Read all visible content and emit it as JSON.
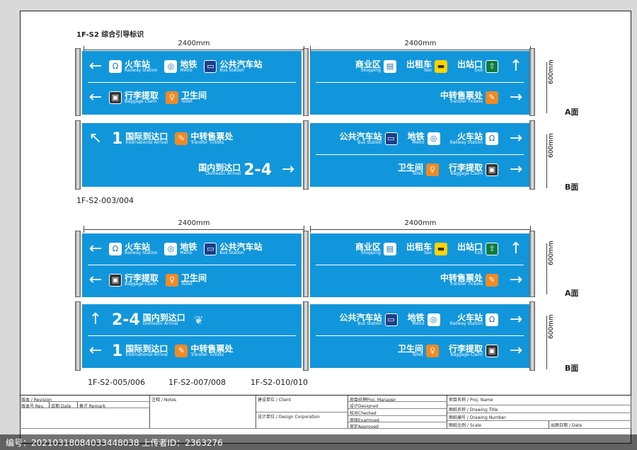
{
  "sheet_title": "1F-S2 综合引导标识",
  "dim_width": "2400mm",
  "dim_height": "600mm",
  "face_a": "A面",
  "face_b": "B面",
  "codes": [
    "1F-S2-003/004",
    "1F-S2-005/006",
    "1F-S2-007/008",
    "1F-S2-010/010"
  ],
  "dest": {
    "railway": {
      "cn": "火车站",
      "en": "Railway Station"
    },
    "metro": {
      "cn": "地铁",
      "en": "Metro"
    },
    "bus": {
      "cn": "公共汽车站",
      "en": "Bus Station"
    },
    "baggage": {
      "cn": "行李提取",
      "en": "Baggage Claim"
    },
    "toilet": {
      "cn": "卫生间",
      "en": "Toilet"
    },
    "shopping": {
      "cn": "商业区",
      "en": "Shopping"
    },
    "taxi": {
      "cn": "出租车",
      "en": "Taxi"
    },
    "exit": {
      "cn": "出站口",
      "en": "Exit"
    },
    "transfer": {
      "cn": "中转售票处",
      "en": "Transfer Tickets"
    },
    "intl": {
      "cn": "国际到达口",
      "en": "International Arrival",
      "num": "1"
    },
    "domestic": {
      "cn": "国内到达口",
      "en": "Domestic Arrival",
      "num": "2-4"
    }
  },
  "title_block": {
    "revision": "版本 / Revision",
    "rev_no": "版本号 Rev.",
    "date": "日期 Date",
    "remark": "备注 Remark",
    "notes": "注释 / Notes",
    "client": "建设单位 / Client",
    "design_corp": "设计单位 / Design Corporation",
    "pm": "项目经理Proj. Manager",
    "designed": "设计Designed",
    "checked": "校对Checked",
    "examined": "审核Examined",
    "approved": "审定Approved",
    "proj_name": "项目名称 / Proj. Name",
    "drawing_title": "图纸名称 / Drawing Title",
    "drawing_number": "图纸编号 / Drawing Number",
    "scale": "图纸比例 / Scale",
    "pub_date": "出图日期 / Date"
  },
  "watermark": "编号：20210318084033448038 上传者ID：2363276"
}
